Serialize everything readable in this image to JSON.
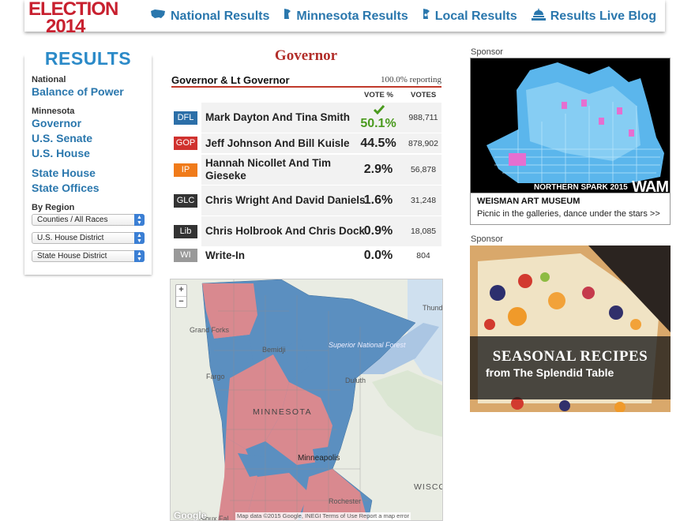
{
  "logo": {
    "line1": "ELECTION",
    "line2": "2014"
  },
  "nav": [
    {
      "label": "National Results",
      "icon": "us-map-icon"
    },
    {
      "label": "Minnesota Results",
      "icon": "minnesota-map-icon"
    },
    {
      "label": "Local Results",
      "icon": "local-map-icon"
    },
    {
      "label": "Results Live Blog",
      "icon": "capitol-icon"
    }
  ],
  "sidebar": {
    "title": "RESULTS",
    "national_label": "National",
    "balance_link": "Balance of Power",
    "minnesota_label": "Minnesota",
    "links": [
      "Governor",
      "U.S. Senate",
      "U.S. House",
      "State House",
      "State Offices"
    ],
    "region_label": "By Region",
    "selects": [
      "Counties / All Races",
      "U.S. House District",
      "State House District"
    ]
  },
  "race": {
    "page_title": "Governor",
    "name": "Governor & Lt Governor",
    "reporting": "100.0% reporting",
    "col_pct": "VOTE %",
    "col_votes": "VOTES",
    "candidates": [
      {
        "party": "DFL",
        "party_color": "#2c6fa8",
        "name": "Mark Dayton And Tina Smith",
        "pct": "50.1%",
        "votes": "988,711",
        "winner": true
      },
      {
        "party": "GOP",
        "party_color": "#d0322f",
        "name": "Jeff Johnson And Bill Kuisle",
        "pct": "44.5%",
        "votes": "878,902"
      },
      {
        "party": "IP",
        "party_color": "#f07b1a",
        "name": "Hannah Nicollet And Tim Gieseke",
        "pct": "2.9%",
        "votes": "56,878"
      },
      {
        "party": "GLC",
        "party_color": "#333333",
        "name": "Chris Wright And David Daniels",
        "pct": "1.6%",
        "votes": "31,248"
      },
      {
        "party": "Lib",
        "party_color": "#333333",
        "name": "Chris Holbrook And Chris Dock",
        "pct": "0.9%",
        "votes": "18,085"
      },
      {
        "party": "WI",
        "party_color": "#999999",
        "name": "Write-In",
        "pct": "0.0%",
        "votes": "804"
      }
    ]
  },
  "map": {
    "zoom_in": "+",
    "zoom_out": "−",
    "labels": [
      "Thunder",
      "Grand Forks",
      "Bemidji",
      "Superior National Forest",
      "Duluth",
      "Fargo",
      "MINNESOTA",
      "Minneapolis",
      "Rochester",
      "WISCO",
      "Sioux Fal"
    ],
    "google": "Google",
    "attribution": "Map data ©2015 Google, INEGI   Terms of Use   Report a map error",
    "colors": {
      "dfl": "#5b8fc0",
      "gop": "#d9898f"
    }
  },
  "sponsors": {
    "label1": "Sponsor",
    "ad1": {
      "tag": "NORTHERN SPARK 2015",
      "brand": "WAM",
      "title": "WEISMAN ART MUSEUM",
      "subtitle": "Picnic in the galleries, dance under the stars >>"
    },
    "label2": "Sponsor",
    "ad2": {
      "title": "SEASONAL RECIPES",
      "subtitle": "from The Splendid Table"
    }
  }
}
